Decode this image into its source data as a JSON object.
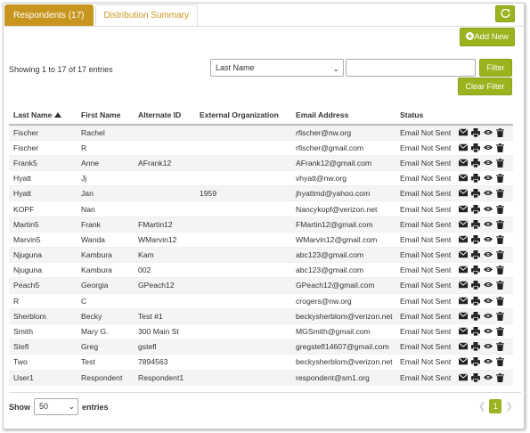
{
  "tabs": [
    {
      "label": "Respondents (17)",
      "active": true
    },
    {
      "label": "Distribution Summary",
      "active": false
    }
  ],
  "toolbar": {
    "refresh_icon": "refresh-icon",
    "add_new_label": "Add New",
    "add_new_icon": "plus-circle-icon",
    "filter_label": "Filter",
    "clear_filter_label": "Clear Filter"
  },
  "info": {
    "showing_text": "Showing 1 to 17 of 17 entries"
  },
  "filter": {
    "field_value": "Last Name",
    "search_value": ""
  },
  "table": {
    "columns": [
      "Last Name",
      "First Name",
      "Alternate ID",
      "External Organization",
      "Email Address",
      "Status"
    ],
    "sort_column": "Last Name",
    "sort_direction": "ascending",
    "rows": [
      [
        "Fischer",
        "Rachel",
        "",
        "",
        "rfischer@nw.org",
        "Email Not Sent"
      ],
      [
        "Fischer",
        "R",
        "",
        "",
        "rfischer@gmail.com",
        "Email Not Sent"
      ],
      [
        "Frank5",
        "Anne",
        "AFrank12",
        "",
        "AFrank12@gmail.com",
        "Email Not Sent"
      ],
      [
        "Hyatt",
        "Jj",
        "",
        "",
        "vhyatt@nw.org",
        "Email Not Sent"
      ],
      [
        "Hyatt",
        "Jan",
        "",
        "1959",
        "jhyattmd@yahoo.com",
        "Email Not Sent"
      ],
      [
        "KOPF",
        "Nan",
        "",
        "",
        "Nancykopf@verizon.net",
        "Email Not Sent"
      ],
      [
        "Martin5",
        "Frank",
        "FMartin12",
        "",
        "FMartin12@gmail.com",
        "Email Not Sent"
      ],
      [
        "Marvin5",
        "Wanda",
        "WMarvin12",
        "",
        "WMarvin12@gmail.com",
        "Email Not Sent"
      ],
      [
        "Njuguna",
        "Kambura",
        "Kam",
        "",
        "abc123@gmail.com",
        "Email Not Sent"
      ],
      [
        "Njuguna",
        "Kambura",
        "002",
        "",
        "abc123@gmail.com",
        "Email Not Sent"
      ],
      [
        "Peach5",
        "Georgia",
        "GPeach12",
        "",
        "GPeach12@gmail.com",
        "Email Not Sent"
      ],
      [
        "R",
        "C",
        "",
        "",
        "crogers@nw.org",
        "Email Not Sent"
      ],
      [
        "Sherblom",
        "Becky",
        "Test #1",
        "",
        "beckysherblom@verizon.net",
        "Email Not Sent"
      ],
      [
        "Smith",
        "Mary G.",
        "300 Main St",
        "",
        "MGSmith@gmail.com",
        "Email Not Sent"
      ],
      [
        "Stefl",
        "Greg",
        "gstefl",
        "",
        "gregstefl14607@gmail.com",
        "Email Not Sent"
      ],
      [
        "Two",
        "Test",
        "7894563",
        "",
        "beckysherblom@verizon.net",
        "Email Not Sent"
      ],
      [
        "User1",
        "Respondent",
        "Respondent1",
        "",
        "respondent@sm1.org",
        "Email Not Sent"
      ]
    ],
    "row_action_icons": [
      "envelope-icon",
      "print-icon",
      "eye-icon",
      "trash-icon"
    ]
  },
  "footer": {
    "show_label": "Show",
    "page_size": "50",
    "entries_label": "entries",
    "current_page": "1"
  },
  "colors": {
    "tab_active": "#c8961f",
    "button_green": "#9bb31f"
  }
}
